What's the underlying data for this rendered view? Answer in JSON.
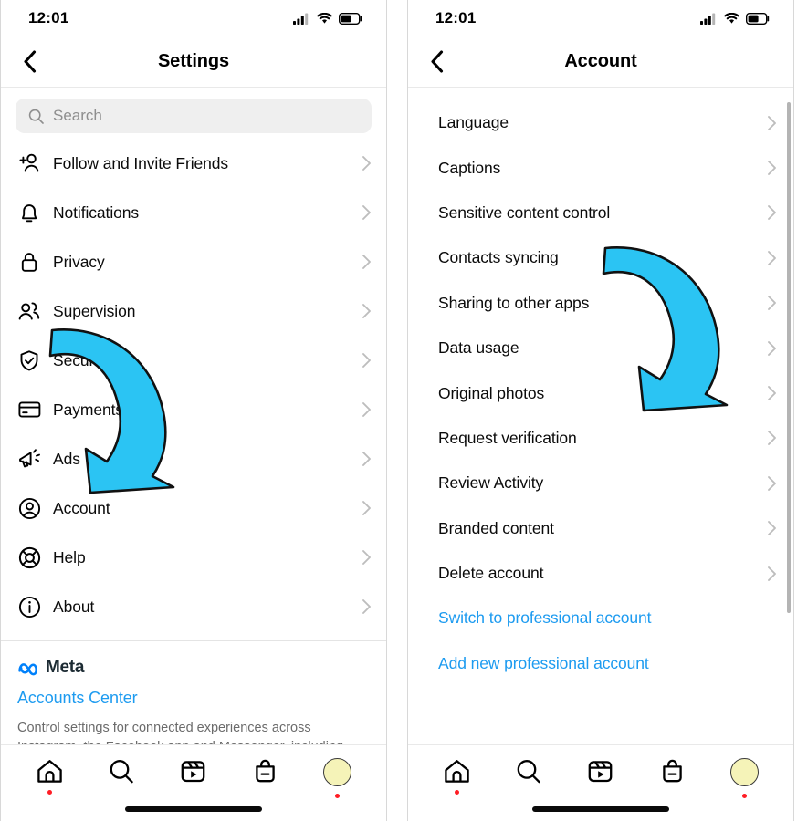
{
  "left_phone": {
    "status": {
      "time": "12:01",
      "signal_icon": "cellular-bars-icon",
      "wifi_icon": "wifi-icon",
      "battery_icon": "battery-icon"
    },
    "nav": {
      "back_icon": "chevron-left-icon",
      "title": "Settings"
    },
    "search": {
      "icon": "search-icon",
      "placeholder": "Search",
      "value": ""
    },
    "items": [
      {
        "label": "Follow and Invite Friends",
        "icon": "person-add-icon",
        "chevron": "chevron-right-icon"
      },
      {
        "label": "Notifications",
        "icon": "bell-icon",
        "chevron": "chevron-right-icon"
      },
      {
        "label": "Privacy",
        "icon": "lock-icon",
        "chevron": "chevron-right-icon"
      },
      {
        "label": "Supervision",
        "icon": "people-icon",
        "chevron": "chevron-right-icon"
      },
      {
        "label": "Security",
        "icon": "shield-check-icon",
        "chevron": "chevron-right-icon"
      },
      {
        "label": "Payments",
        "icon": "credit-card-icon",
        "chevron": "chevron-right-icon"
      },
      {
        "label": "Ads",
        "icon": "megaphone-icon",
        "chevron": "chevron-right-icon"
      },
      {
        "label": "Account",
        "icon": "account-circle-icon",
        "chevron": "chevron-right-icon"
      },
      {
        "label": "Help",
        "icon": "lifebuoy-icon",
        "chevron": "chevron-right-icon"
      },
      {
        "label": "About",
        "icon": "info-circle-icon",
        "chevron": "chevron-right-icon"
      }
    ],
    "meta": {
      "logo_icon": "meta-infinity-icon",
      "wordmark": "Meta",
      "accounts_center": "Accounts Center",
      "description": "Control settings for connected experiences across Instagram, the Facebook app and Messenger, including"
    },
    "tabbar": [
      {
        "name": "home",
        "icon": "home-icon",
        "badge": true
      },
      {
        "name": "search",
        "icon": "search-icon",
        "badge": false
      },
      {
        "name": "reels",
        "icon": "reels-icon",
        "badge": false
      },
      {
        "name": "shop",
        "icon": "shop-bag-icon",
        "badge": false
      },
      {
        "name": "profile",
        "icon": "avatar-icon",
        "badge": true
      }
    ]
  },
  "right_phone": {
    "status": {
      "time": "12:01",
      "signal_icon": "cellular-bars-icon",
      "wifi_icon": "wifi-icon",
      "battery_icon": "battery-icon"
    },
    "nav": {
      "back_icon": "chevron-left-icon",
      "title": "Account"
    },
    "items": [
      {
        "label": "Language",
        "chevron": "chevron-right-icon",
        "link": false
      },
      {
        "label": "Captions",
        "chevron": "chevron-right-icon",
        "link": false
      },
      {
        "label": "Sensitive content control",
        "chevron": "chevron-right-icon",
        "link": false
      },
      {
        "label": "Contacts syncing",
        "chevron": "chevron-right-icon",
        "link": false
      },
      {
        "label": "Sharing to other apps",
        "chevron": "chevron-right-icon",
        "link": false
      },
      {
        "label": "Data usage",
        "chevron": "chevron-right-icon",
        "link": false
      },
      {
        "label": "Original photos",
        "chevron": "chevron-right-icon",
        "link": false
      },
      {
        "label": "Request verification",
        "chevron": "chevron-right-icon",
        "link": false
      },
      {
        "label": "Review Activity",
        "chevron": "chevron-right-icon",
        "link": false
      },
      {
        "label": "Branded content",
        "chevron": "chevron-right-icon",
        "link": false
      },
      {
        "label": "Delete account",
        "chevron": "chevron-right-icon",
        "link": false
      },
      {
        "label": "Switch to professional account",
        "chevron": "",
        "link": true
      },
      {
        "label": "Add new professional account",
        "chevron": "",
        "link": true
      }
    ],
    "tabbar": [
      {
        "name": "home",
        "icon": "home-icon",
        "badge": true
      },
      {
        "name": "search",
        "icon": "search-icon",
        "badge": false
      },
      {
        "name": "reels",
        "icon": "reels-icon",
        "badge": false
      },
      {
        "name": "shop",
        "icon": "shop-bag-icon",
        "badge": false
      },
      {
        "name": "profile",
        "icon": "avatar-icon",
        "badge": true
      }
    ]
  },
  "annotations": {
    "left_arrow": {
      "icon": "curved-down-arrow-icon",
      "points_to": "Account",
      "color": "#2BC4F3"
    },
    "right_arrow": {
      "icon": "curved-down-arrow-icon",
      "points_to": "Switch to professional account",
      "color": "#2BC4F3"
    }
  },
  "colors": {
    "accent_blue": "#1d9bf0",
    "arrow_cyan": "#2BC4F3",
    "meta_blue": "#0081FB",
    "badge_red": "#ff1d25",
    "avatar_yellow": "#f5f3b8"
  }
}
